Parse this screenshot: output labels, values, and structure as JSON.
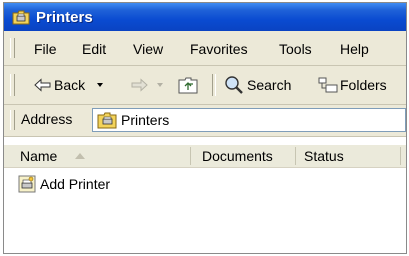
{
  "window": {
    "title": "Printers"
  },
  "menu": {
    "file": "File",
    "edit": "Edit",
    "view": "View",
    "favorites": "Favorites",
    "tools": "Tools",
    "help": "Help"
  },
  "toolbar": {
    "back_label": "Back",
    "search_label": "Search",
    "folders_label": "Folders"
  },
  "address": {
    "label": "Address",
    "value": "Printers"
  },
  "columns": {
    "name": "Name",
    "documents": "Documents",
    "status": "Status"
  },
  "items": [
    {
      "label": "Add Printer",
      "icon": "add-printer-icon"
    }
  ],
  "colors": {
    "titlebar": "#0a4bd1",
    "chrome": "#ece9d8"
  }
}
